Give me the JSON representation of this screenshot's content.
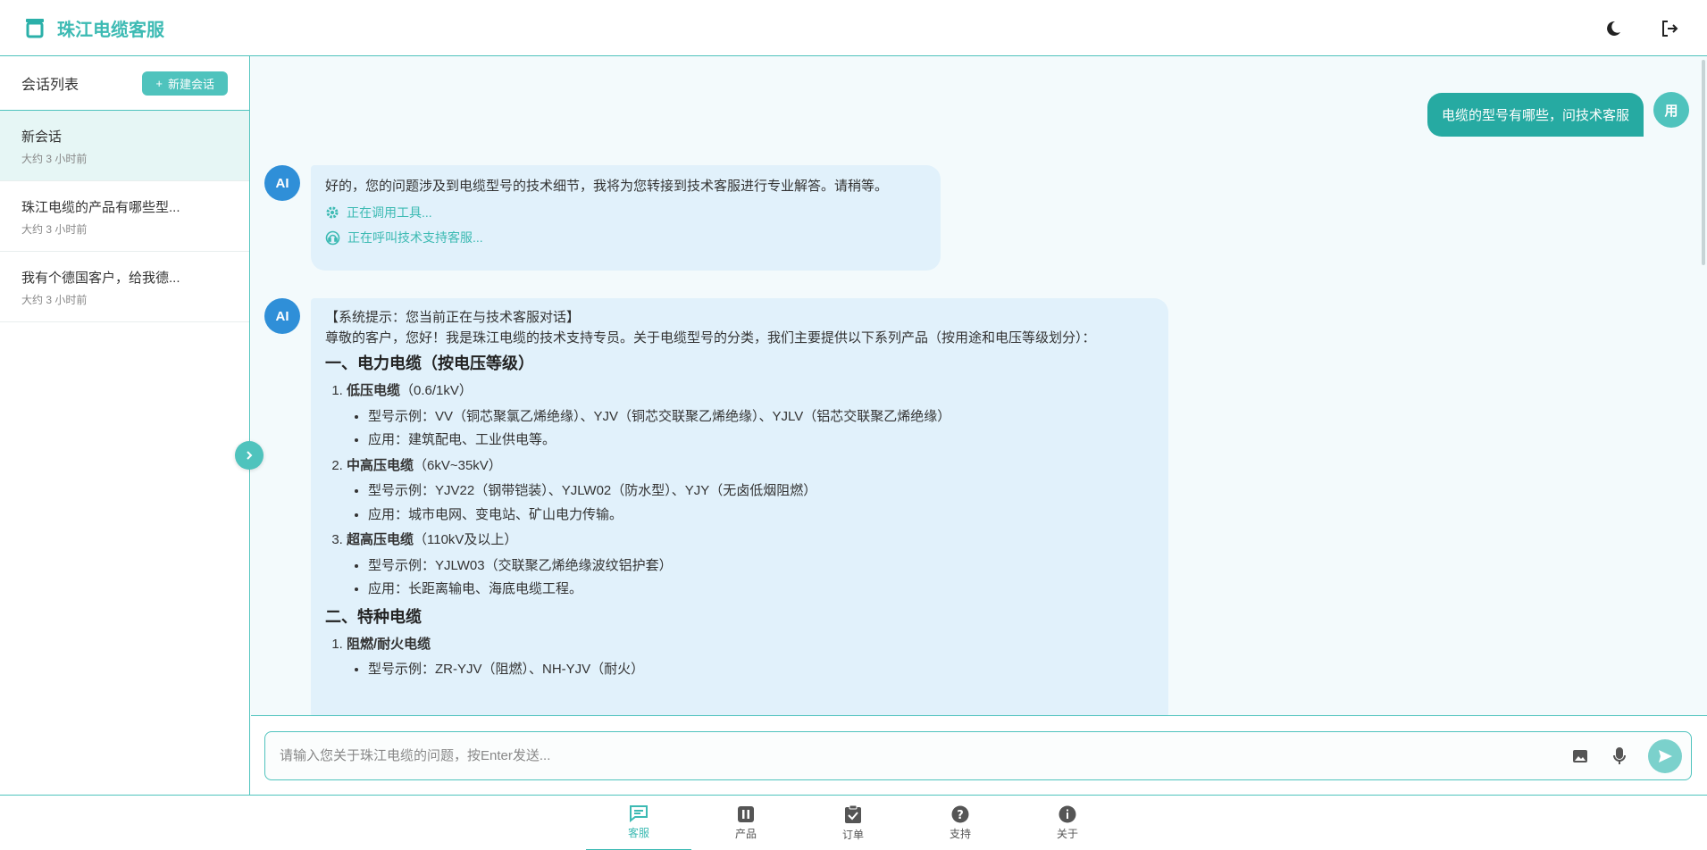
{
  "app": {
    "title": "珠江电缆客服"
  },
  "header": {
    "theme_icon": "moon-icon",
    "logout_icon": "logout-icon"
  },
  "sidebar": {
    "title": "会话列表",
    "new_chat_label": "新建会话",
    "conversations": [
      {
        "title": "新会话",
        "time": "大约 3 小时前",
        "active": true
      },
      {
        "title": "珠江电缆的产品有哪些型...",
        "time": "大约 3 小时前",
        "active": false
      },
      {
        "title": "我有个德国客户，给我德...",
        "time": "大约 3 小时前",
        "active": false
      }
    ]
  },
  "chat": {
    "user_avatar": "用",
    "ai_avatar": "AI",
    "user_message": "电缆的型号有哪些，问技术客服",
    "ai_message_1": {
      "text": "好的，您的问题涉及到电缆型号的技术细节，我将为您转接到技术客服进行专业解答。请稍等。",
      "tool_1": "正在调用工具...",
      "tool_2": "正在呼叫技术支持客服..."
    },
    "ai_message_2": {
      "system_note": "【系统提示：您当前正在与技术客服对话】",
      "intro": "尊敬的客户，您好！我是珠江电缆的技术支持专员。关于电缆型号的分类，我们主要提供以下系列产品（按用途和电压等级划分）：",
      "section_1": {
        "heading": "一、电力电缆（按电压等级）",
        "items": [
          {
            "num": "1.",
            "name": "低压电缆",
            "spec": "（0.6/1kV）",
            "bullets": [
              "型号示例：VV（铜芯聚氯乙烯绝缘）、YJV（铜芯交联聚乙烯绝缘）、YJLV（铝芯交联聚乙烯绝缘）",
              "应用：建筑配电、工业供电等。"
            ]
          },
          {
            "num": "2.",
            "name": "中高压电缆",
            "spec": "（6kV~35kV）",
            "bullets": [
              "型号示例：YJV22（钢带铠装）、YJLW02（防水型）、YJY（无卤低烟阻燃）",
              "应用：城市电网、变电站、矿山电力传输。"
            ]
          },
          {
            "num": "3.",
            "name": "超高压电缆",
            "spec": "（110kV及以上）",
            "bullets": [
              "型号示例：YJLW03（交联聚乙烯绝缘波纹铝护套）",
              "应用：长距离输电、海底电缆工程。"
            ]
          }
        ]
      },
      "section_2": {
        "heading": "二、特种电缆",
        "items": [
          {
            "num": "1.",
            "name": "阻燃/耐火电缆",
            "bullets": [
              "型号示例：ZR-YJV（阻燃）、NH-YJV（耐火）"
            ]
          }
        ]
      }
    }
  },
  "input": {
    "placeholder": "请输入您关于珠江电缆的问题，按Enter发送..."
  },
  "bottom_nav": [
    {
      "label": "客服",
      "icon": "chat-icon",
      "active": true
    },
    {
      "label": "产品",
      "icon": "product-icon",
      "active": false
    },
    {
      "label": "订单",
      "icon": "order-icon",
      "active": false
    },
    {
      "label": "支持",
      "icon": "help-icon",
      "active": false
    },
    {
      "label": "关于",
      "icon": "info-icon",
      "active": false
    }
  ],
  "colors": {
    "accent": "#4fc3bd",
    "accent_dark": "#26aaa2",
    "ai_avatar": "#2f8fd8",
    "ai_bubble": "#e1f1fb"
  }
}
